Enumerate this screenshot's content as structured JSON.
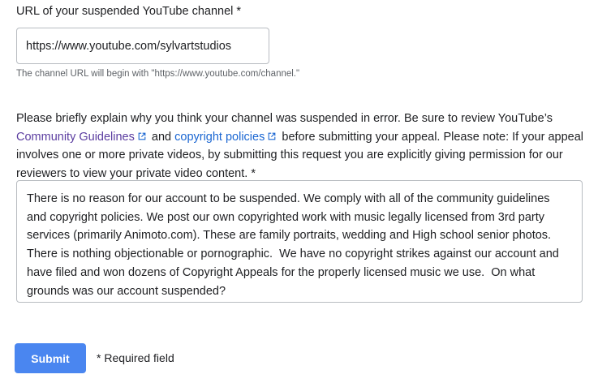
{
  "channel_url": {
    "label": "URL of your suspended YouTube channel *",
    "value": "https://www.youtube.com/sylvartstudios",
    "hint": "The channel URL will begin with \"https://www.youtube.com/channel.\""
  },
  "explanation": {
    "text_1": "Please briefly explain why you think your channel was suspended in error. Be sure to review YouTube’s ",
    "link_guidelines": "Community Guidelines",
    "text_2": " and ",
    "link_copyright": "copyright policies",
    "text_3": " before submitting your appeal. Please note: If your appeal involves one or more private videos, by submitting this request you are explicitly giving permission for our reviewers to view your private video content. *",
    "value": "There is no reason for our account to be suspended. We comply with all of the community guidelines and copyright policies. We post our own copyrighted work with music legally licensed from 3rd party services (primarily Animoto.com). These are family portraits, wedding and High school senior photos.  There is nothing objectionable or pornographic.  We have no copyright strikes against our account and have filed and won dozens of Copyright Appeals for the properly licensed music we use.  On what grounds was our account suspended?"
  },
  "form_actions": {
    "submit_label": "Submit",
    "required_note": "* Required field"
  },
  "colors": {
    "submit_background": "#4a86f0",
    "visited_link": "#5b3da0",
    "link": "#1a66d2"
  },
  "icons": {
    "external_link": "external-link-icon"
  }
}
